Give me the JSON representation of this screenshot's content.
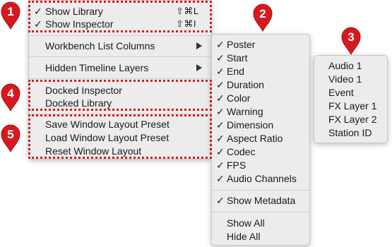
{
  "main_menu": {
    "show_library": {
      "label": "Show Library",
      "checked": true,
      "shortcut": "⇧⌘L"
    },
    "show_inspector": {
      "label": "Show Inspector",
      "checked": true,
      "shortcut": "⇧⌘I"
    },
    "workbench_list_columns": "Workbench List Columns",
    "hidden_timeline_layers": "Hidden Timeline Layers",
    "docked_inspector": "Docked Inspector",
    "docked_library": "Docked Library",
    "save_layout": "Save Window Layout Preset",
    "load_layout": "Load Window Layout Preset",
    "reset_layout": "Reset Window Layout"
  },
  "columns_menu": {
    "items": [
      "Poster",
      "Start",
      "End",
      "Duration",
      "Color",
      "Warning",
      "Dimension",
      "Aspect Ratio",
      "Codec",
      "FPS",
      "Audio Channels"
    ],
    "show_metadata": "Show Metadata",
    "show_all": "Show All",
    "hide_all": "Hide All"
  },
  "layers_menu": {
    "items": [
      "Audio 1",
      "Video 1",
      "Event",
      "FX Layer 1",
      "FX Layer 2",
      "Station ID"
    ]
  },
  "check_glyph": "✓",
  "badges": [
    "1",
    "2",
    "3",
    "4",
    "5"
  ],
  "colors": {
    "accent": "#d7191f",
    "menu_bg": "#ececec"
  }
}
